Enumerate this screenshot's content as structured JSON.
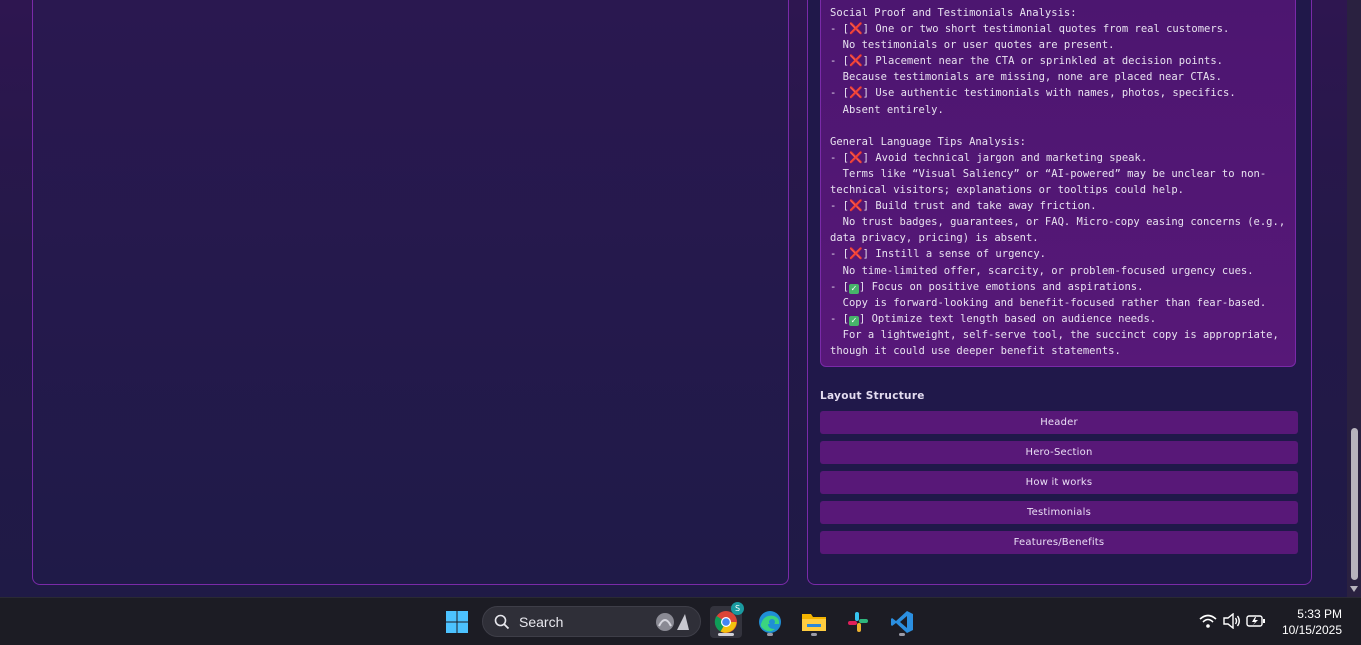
{
  "analysis": {
    "lines": [
      [
        {
          "t": "Social Proof and Testimonials Analysis:"
        }
      ],
      [
        {
          "t": "- ["
        },
        {
          "m": "x"
        },
        {
          "t": "] One or two short testimonial quotes from real customers."
        }
      ],
      [
        {
          "t": "  No testimonials or user quotes are present."
        }
      ],
      [
        {
          "t": "- ["
        },
        {
          "m": "x"
        },
        {
          "t": "] Placement near the CTA or sprinkled at decision points."
        }
      ],
      [
        {
          "t": "  Because testimonials are missing, none are placed near CTAs."
        }
      ],
      [
        {
          "t": "- ["
        },
        {
          "m": "x"
        },
        {
          "t": "] Use authentic testimonials with names, photos, specifics."
        }
      ],
      [
        {
          "t": "  Absent entirely."
        }
      ],
      [
        {
          "t": ""
        }
      ],
      [
        {
          "t": "General Language Tips Analysis:"
        }
      ],
      [
        {
          "t": "- ["
        },
        {
          "m": "x"
        },
        {
          "t": "] Avoid technical jargon and marketing speak."
        }
      ],
      [
        {
          "t": "  Terms like “Visual Saliency” or “AI-powered” may be unclear to non-"
        }
      ],
      [
        {
          "t": "technical visitors; explanations or tooltips could help."
        }
      ],
      [
        {
          "t": "- ["
        },
        {
          "m": "x"
        },
        {
          "t": "] Build trust and take away friction."
        }
      ],
      [
        {
          "t": "  No trust badges, guarantees, or FAQ. Micro-copy easing concerns (e.g.,"
        }
      ],
      [
        {
          "t": "data privacy, pricing) is absent."
        }
      ],
      [
        {
          "t": "- ["
        },
        {
          "m": "x"
        },
        {
          "t": "] Instill a sense of urgency."
        }
      ],
      [
        {
          "t": "  No time-limited offer, scarcity, or problem-focused urgency cues."
        }
      ],
      [
        {
          "t": "- ["
        },
        {
          "m": "ok"
        },
        {
          "t": "] Focus on positive emotions and aspirations."
        }
      ],
      [
        {
          "t": "  Copy is forward-looking and benefit-focused rather than fear-based."
        }
      ],
      [
        {
          "t": "- ["
        },
        {
          "m": "ok"
        },
        {
          "t": "] Optimize text length based on audience needs."
        }
      ],
      [
        {
          "t": "  For a lightweight, self-serve tool, the succinct copy is appropriate,"
        }
      ],
      [
        {
          "t": "though it could use deeper benefit statements."
        }
      ]
    ]
  },
  "layout_structure": {
    "title": "Layout Structure",
    "items": [
      "Header",
      "Hero-Section",
      "How it works",
      "Testimonials",
      "Features/Benefits"
    ]
  },
  "taskbar": {
    "search_label": "Search",
    "chrome_badge": "S",
    "time": "5:33 PM",
    "date": "10/15/2025"
  },
  "colors": {
    "accent_border": "#7a2aa8",
    "item_bg": "#581878",
    "fail_mark": "#ff3355",
    "pass_mark": "#47b36a"
  },
  "icons": [
    "windows-start-icon",
    "search-icon",
    "chrome-icon",
    "edge-icon",
    "file-explorer-icon",
    "slack-icon",
    "vscode-icon",
    "wifi-icon",
    "volume-icon",
    "battery-icon"
  ]
}
